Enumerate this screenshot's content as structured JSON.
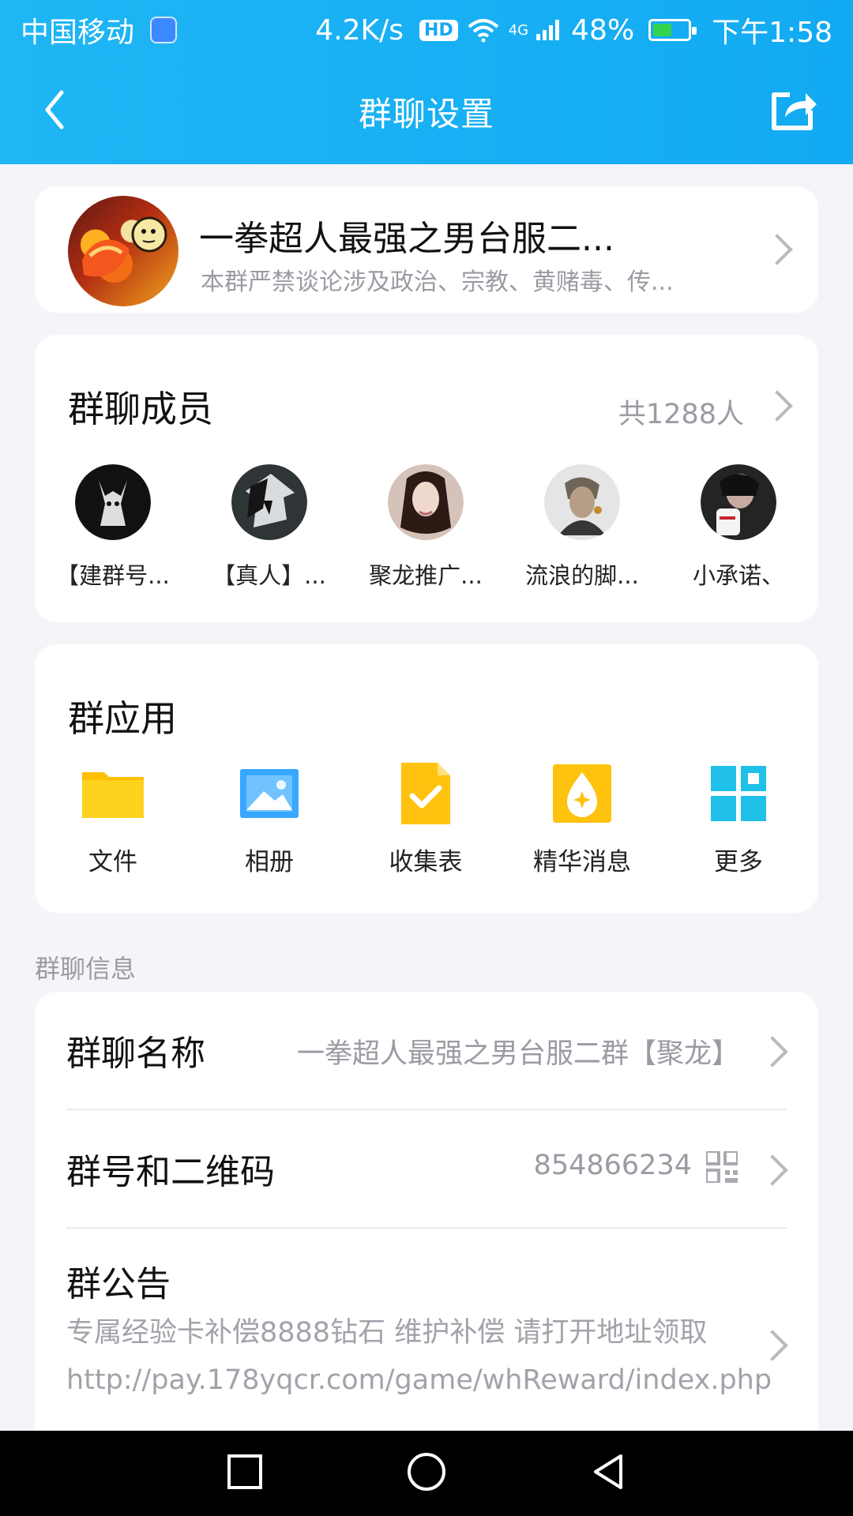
{
  "status_bar": {
    "carrier": "中国移动",
    "speed": "4.2K/s",
    "hd": "HD",
    "network": "4G",
    "battery_percent": "48%",
    "time": "下午1:58",
    "battery_level": 0.48
  },
  "header": {
    "title": "群聊设置",
    "back_icon": "chevron-left-icon",
    "share_icon": "share-icon"
  },
  "group": {
    "name": "一拳超人最强之男台服二...",
    "description": "本群严禁谈论涉及政治、宗教、黄赌毒、传..."
  },
  "members": {
    "title": "群聊成员",
    "count": "共1288人",
    "items": [
      {
        "name": "【建群号..."
      },
      {
        "name": "【真人】..."
      },
      {
        "name": "聚龙推广..."
      },
      {
        "name": "流浪的脚..."
      },
      {
        "name": "小承诺、"
      }
    ]
  },
  "apps": {
    "title": "群应用",
    "items": [
      {
        "label": "文件",
        "icon": "folder-icon"
      },
      {
        "label": "相册",
        "icon": "photo-icon"
      },
      {
        "label": "收集表",
        "icon": "form-check-icon"
      },
      {
        "label": "精华消息",
        "icon": "essence-icon"
      },
      {
        "label": "更多",
        "icon": "grid-icon"
      }
    ]
  },
  "info": {
    "section_label": "群聊信息",
    "rows": [
      {
        "title": "群聊名称",
        "value": "一拳超人最强之男台服二群【聚龙】"
      },
      {
        "title": "群号和二维码",
        "value": "854866234"
      },
      {
        "title": "群公告",
        "value": "专属经验卡补偿8888钻石 维护补偿 请打开地址领取 http://pay.178yqcr.com/game/whReward/index.php"
      }
    ]
  },
  "colors": {
    "header": "#17aff3",
    "accent": "#ffc11f",
    "background": "#f4f5f9"
  }
}
